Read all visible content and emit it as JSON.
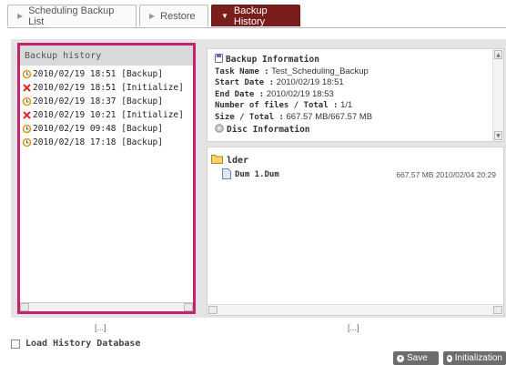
{
  "tabs": [
    {
      "label": "Scheduling Backup List",
      "active": false
    },
    {
      "label": "Restore",
      "active": false
    },
    {
      "label": "Backup History",
      "active": true
    }
  ],
  "history": {
    "title": "Backup history",
    "items": [
      {
        "text": "2010/02/19 18:51 [Backup]",
        "icon": "backup-icon"
      },
      {
        "text": "2010/02/19 18:51 [Initialize]",
        "icon": "x-icon"
      },
      {
        "text": "2010/02/19 18:37 [Backup]",
        "icon": "backup-icon"
      },
      {
        "text": "2010/02/19 10:21 [Initialize]",
        "icon": "x-icon"
      },
      {
        "text": "2010/02/19 09:48 [Backup]",
        "icon": "backup-icon"
      },
      {
        "text": "2010/02/18 17:18 [Backup]",
        "icon": "backup-icon"
      }
    ],
    "ellipsis": "[...]"
  },
  "info": {
    "title": "Backup Information",
    "task_name_label": "Task Name :",
    "task_name": "Test_Scheduling_Backup",
    "start_date_label": "Start Date :",
    "start_date": "2010/02/19 18:51",
    "end_date_label": "End Date :",
    "end_date": "2010/02/19 18:53",
    "num_files_label": "Number of files / Total :",
    "num_files": "1/1",
    "size_label": "Size / Total :",
    "size": "667.57 MB/667.57 MB",
    "disc_label": "Disc Information"
  },
  "files": {
    "folder": "lder",
    "file_name": "Dum 1.Dum",
    "file_meta": "667.57 MB  2010/02/04 20:29",
    "ellipsis": "[...]"
  },
  "footer": {
    "load_label": "Load History Database",
    "save_label": "Save",
    "init_label": "Initialization"
  },
  "colors": {
    "active_tab": "#7a1d1d",
    "highlight_border": "#c52270",
    "x_red": "#e0252a",
    "backup_orange": "#d99a1e"
  }
}
